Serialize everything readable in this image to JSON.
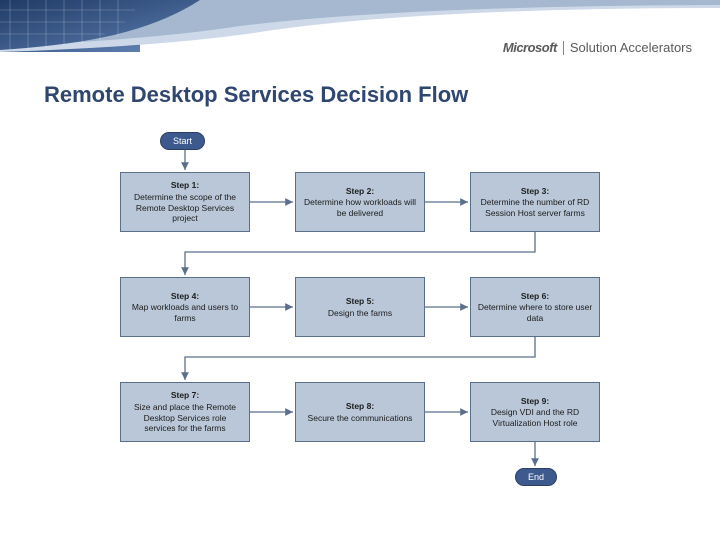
{
  "brand": {
    "company": "Microsoft",
    "program": "Solution Accelerators"
  },
  "title": "Remote Desktop Services Decision Flow",
  "flow": {
    "start": "Start",
    "end": "End",
    "steps": [
      {
        "label": "Step 1:",
        "text": "Determine the scope of the Remote Desktop Services project"
      },
      {
        "label": "Step 2:",
        "text": "Determine how workloads will be delivered"
      },
      {
        "label": "Step 3:",
        "text": "Determine the number of RD Session Host server farms"
      },
      {
        "label": "Step 4:",
        "text": "Map workloads and users to farms"
      },
      {
        "label": "Step 5:",
        "text": "Design the farms"
      },
      {
        "label": "Step 6:",
        "text": "Determine where to store user data"
      },
      {
        "label": "Step 7:",
        "text": "Size and place the Remote Desktop Services role services for the farms"
      },
      {
        "label": "Step 8:",
        "text": "Secure the communications"
      },
      {
        "label": "Step 9:",
        "text": "Design VDI and the RD Virtualization Host role"
      }
    ]
  }
}
